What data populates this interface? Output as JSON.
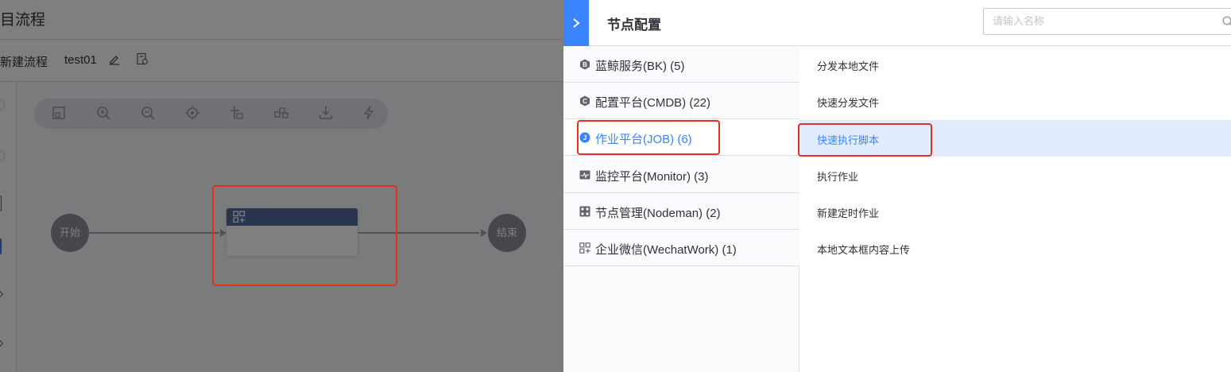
{
  "editor": {
    "title": "目流程",
    "breadcrumb": "新建流程",
    "flow_name": "test01",
    "start_node": "开始",
    "end_node": "结束"
  },
  "panel": {
    "title": "节点配置",
    "search_placeholder": "请输入名称",
    "categories": [
      {
        "label": "蓝鲸服务(BK) (5)",
        "icon": "bk-service-icon"
      },
      {
        "label": "配置平台(CMDB) (22)",
        "icon": "cmdb-icon"
      },
      {
        "label": "作业平台(JOB) (6)",
        "icon": "job-icon",
        "active": true
      },
      {
        "label": "监控平台(Monitor) (3)",
        "icon": "monitor-icon"
      },
      {
        "label": "节点管理(Nodeman) (2)",
        "icon": "nodeman-icon"
      },
      {
        "label": "企业微信(WechatWork) (1)",
        "icon": "wechat-work-icon"
      }
    ],
    "plugins": [
      {
        "label": "分发本地文件"
      },
      {
        "label": "快速分发文件"
      },
      {
        "label": "快速执行脚本",
        "active": true
      },
      {
        "label": "执行作业"
      },
      {
        "label": "新建定时作业"
      },
      {
        "label": "本地文本框内容上传"
      }
    ]
  },
  "colors": {
    "accent": "#3a84ff",
    "highlight_box": "#e5301e",
    "task_header": "#52699d",
    "active_row": "#e1ecff"
  }
}
